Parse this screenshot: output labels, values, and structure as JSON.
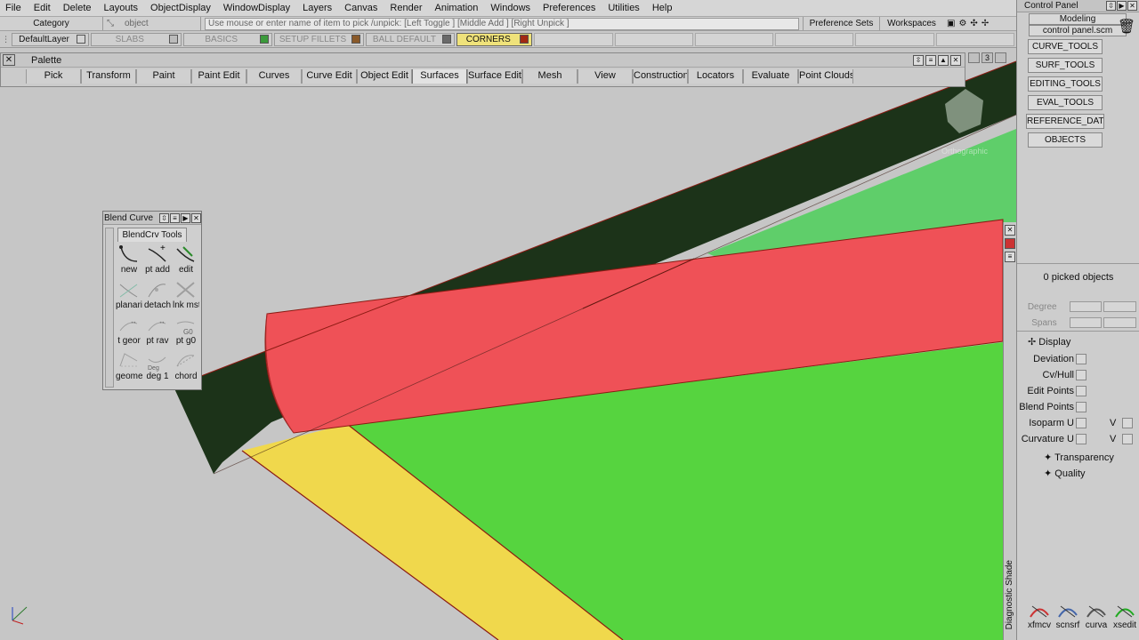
{
  "menubar": {
    "items": [
      "File",
      "Edit",
      "Delete",
      "Layouts",
      "ObjectDisplay",
      "WindowDisplay",
      "Layers",
      "Canvas",
      "Render",
      "Animation",
      "Windows",
      "Preferences",
      "Utilities",
      "Help"
    ]
  },
  "row2": {
    "category_label": "Category",
    "pick_object_label": "object",
    "pick_hint": "Use mouse or enter name of item to pick /unpick: [Left Toggle ] [Middle Add ] [Right Unpick ]",
    "preference_sets_label": "Preference Sets",
    "workspaces_label": "Workspaces"
  },
  "layers": {
    "items": [
      {
        "name": "DefaultLayer",
        "state": "normal",
        "swatch": "#d4d4d4"
      },
      {
        "name": "SLABS",
        "state": "dim",
        "swatch": "#bbbbbb"
      },
      {
        "name": "BASICS",
        "state": "dim",
        "swatch": "#3b9a3b"
      },
      {
        "name": "SETUP FILLETS",
        "state": "dim",
        "swatch": "#8a5a2a"
      },
      {
        "name": "BALL DEFAULT",
        "state": "dim",
        "swatch": "#6a6a6a"
      },
      {
        "name": "CORNERS",
        "state": "active",
        "swatch": "#a22a12"
      }
    ]
  },
  "palette": {
    "title": "Palette",
    "tabs": [
      "Pick",
      "Transform",
      "Paint",
      "Paint Edit",
      "Curves",
      "Curve Edit",
      "Object Edit",
      "Surfaces",
      "Surface Edit",
      "Mesh",
      "View",
      "Construction",
      "Locators",
      "Evaluate",
      "Point Clouds"
    ],
    "active_tab": "Surfaces",
    "view_number": "3"
  },
  "blend_window": {
    "title": "Blend Curve",
    "tab": "BlendCrv Tools",
    "tools": [
      {
        "label": "new",
        "dim": false
      },
      {
        "label": "pt add",
        "dim": false
      },
      {
        "label": "edit",
        "dim": false
      },
      {
        "label": "planari",
        "dim": true
      },
      {
        "label": "detach",
        "dim": true
      },
      {
        "label": "lnk mst",
        "dim": true
      },
      {
        "label": "t geor",
        "dim": true
      },
      {
        "label": "pt rav",
        "dim": true
      },
      {
        "label": "pt g0",
        "dim": true
      },
      {
        "label": "geome",
        "dim": true
      },
      {
        "label": "deg 1",
        "dim": true
      },
      {
        "label": "chord",
        "dim": true
      }
    ]
  },
  "viewport": {
    "view_tag": "Orthographic",
    "side_label": "Diagnostic Shade",
    "colors": {
      "background": "#c6c6c6",
      "dark_surface": "#1c3319",
      "green_surface": "#56d43f",
      "light_green_surface": "#5fce6a",
      "red_surface": "#ef5157",
      "yellow_surface": "#f0d84c",
      "edge": "#8a1a12"
    }
  },
  "control_panel": {
    "title": "Control Panel",
    "mode": "Modeling",
    "file": "control panel.scm",
    "tool_buttons": [
      "CURVE_TOOLS",
      "SURF_TOOLS",
      "EDITING_TOOLS",
      "EVAL_TOOLS",
      "REFERENCE_DATA",
      "OBJECTS"
    ],
    "picked_objects": "0 picked objects",
    "degree_label": "Degree",
    "spans_label": "Spans",
    "display_label": "Display",
    "options": [
      "Deviation",
      "Cv/Hull",
      "Edit Points",
      "Blend Points",
      "Isoparm U",
      "Curvature U"
    ],
    "v_label": "V",
    "sub_items": [
      "Transparency",
      "Quality"
    ],
    "bottom_tools": [
      "xfmcv",
      "scnsrf",
      "curva",
      "xsedit"
    ]
  }
}
